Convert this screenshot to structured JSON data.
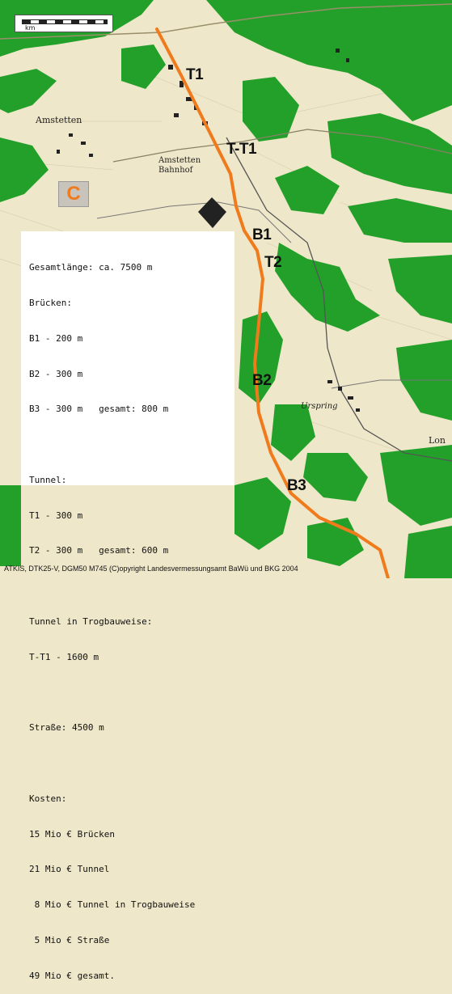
{
  "map": {
    "scale_label": "km",
    "area_badge": "C",
    "segments": [
      {
        "id": "T1",
        "label": "T1"
      },
      {
        "id": "T-T1",
        "label": "T-T1"
      },
      {
        "id": "B1",
        "label": "B1"
      },
      {
        "id": "T2",
        "label": "T2"
      },
      {
        "id": "B2",
        "label": "B2"
      },
      {
        "id": "B3",
        "label": "B3"
      }
    ],
    "places": [
      "Amstetten",
      "Amstetten Bahnhof",
      "Urspring",
      "Lon"
    ],
    "route_color": "#f07b1c",
    "forest_color": "#22a02a",
    "background_color": "#efe7c9"
  },
  "info": {
    "lines": [
      "Gesamtlänge: ca. 7500 m",
      "Brücken:",
      "B1 - 200 m",
      "B2 - 300 m",
      "B3 - 300 m   gesamt: 800 m",
      "",
      "Tunnel:",
      "T1 - 300 m",
      "T2 - 300 m   gesamt: 600 m",
      "",
      "Tunnel in Trogbauweise:",
      "T-T1 - 1600 m",
      "",
      "Straße: 4500 m",
      "",
      "Kosten:",
      "15 Mio € Brücken",
      "21 Mio € Tunnel",
      " 8 Mio € Tunnel in Trogbauweise",
      " 5 Mio € Straße",
      "49 Mio € gesamt."
    ]
  },
  "copyright": "ATKIS, DTK25-V, DGM50 M745 (C)opyright Landesvermessungsamt BaWü und BKG 2004"
}
